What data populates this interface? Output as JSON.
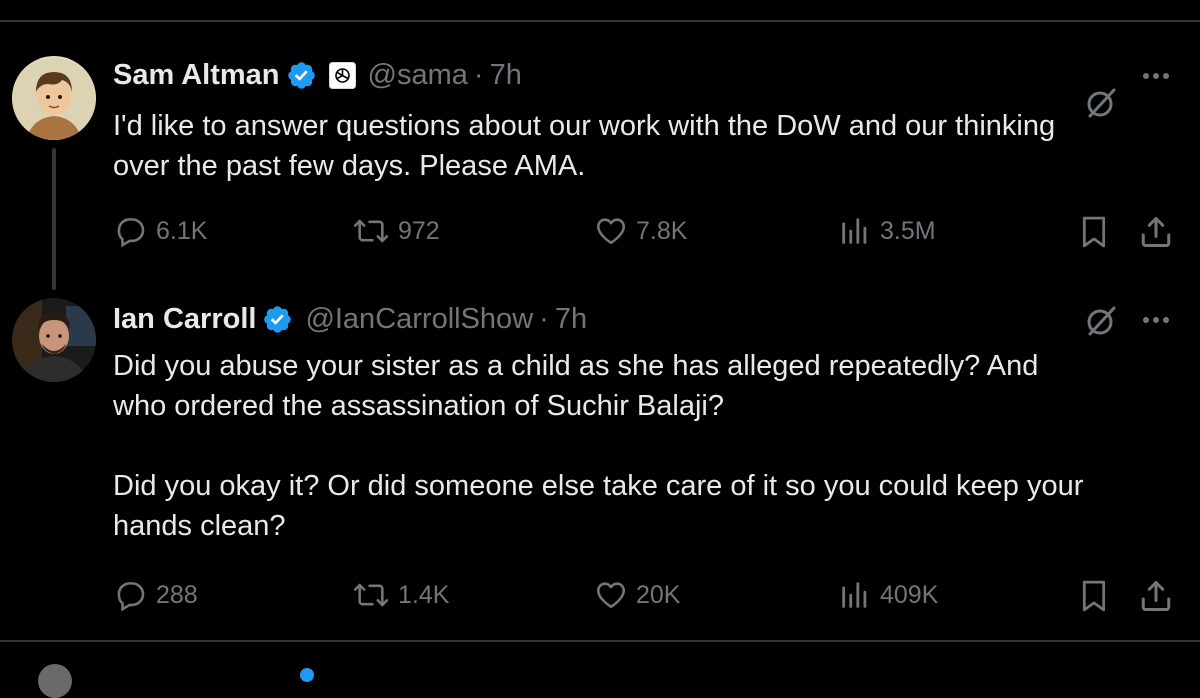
{
  "colors": {
    "background": "#000000",
    "text": "#e7e9ea",
    "muted": "#71767b",
    "verified": "#1d9bf0",
    "divider": "#2f3336"
  },
  "tweets": [
    {
      "author_name": "Sam Altman",
      "verified_icon": "verified-badge-icon",
      "affiliate_icon": "openai-logo-icon",
      "handle": "@sama",
      "separator": "·",
      "time": "7h",
      "text": "I'd like to answer questions about our work with the DoW and our thinking\nover the past few days. Please AMA.",
      "replies": "6.1K",
      "reposts": "972",
      "likes": "7.8K",
      "views": "3.5M"
    },
    {
      "author_name": "Ian Carroll",
      "verified_icon": "verified-badge-icon",
      "handle": "@IanCarrollShow",
      "separator": "·",
      "time": "7h",
      "text": "Did you abuse your sister as a child as she has alleged repeatedly? And\nwho ordered the assassination of Suchir Balaji?\n\nDid you okay it? Or did someone else take care of it so you could keep your\nhands clean?",
      "replies": "288",
      "reposts": "1.4K",
      "likes": "20K",
      "views": "409K"
    }
  ]
}
